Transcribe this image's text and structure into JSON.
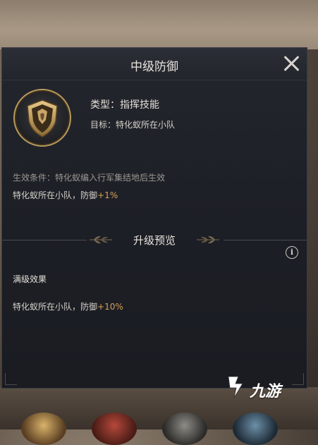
{
  "dialog": {
    "title": "中级防御",
    "type_line": "类型：指挥技能",
    "target_line": "目标：特化蚁所在小队",
    "condition": "生效条件：特化蚁编入行军集结地后生效",
    "current_effect": {
      "text": "特化蚁所在小队，防御",
      "value": "+1%"
    },
    "upgrade_preview_title": "升级预览",
    "max_effect_label": "满级效果",
    "max_effect": {
      "text": "特化蚁所在小队，防御",
      "value": "+10%"
    }
  },
  "icons": {
    "close": "close-icon",
    "info": "info-icon",
    "skill": "shield-emblem-icon"
  },
  "colors": {
    "accent": "#d7a05a",
    "panel_bg": "#1d1f26",
    "icon_ring": "#b89a5c"
  },
  "watermark": {
    "text": "九游"
  }
}
